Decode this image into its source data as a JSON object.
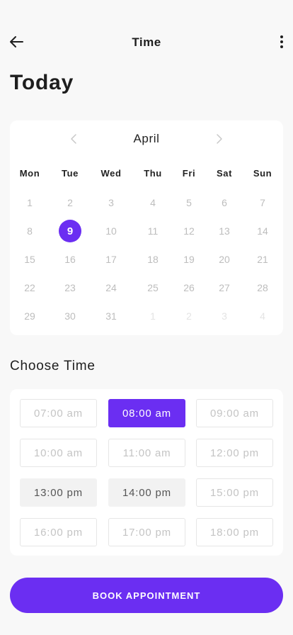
{
  "header": {
    "title": "Time",
    "back_icon": "arrow-left-icon",
    "menu_icon": "more-vertical-icon"
  },
  "page_heading": "Today",
  "calendar": {
    "month": "April",
    "prev_icon": "chevron-left-icon",
    "next_icon": "chevron-right-icon",
    "weekdays": [
      "Mon",
      "Tue",
      "Wed",
      "Thu",
      "Fri",
      "Sat",
      "Sun"
    ],
    "weeks": [
      [
        {
          "d": "1"
        },
        {
          "d": "2"
        },
        {
          "d": "3"
        },
        {
          "d": "4"
        },
        {
          "d": "5"
        },
        {
          "d": "6"
        },
        {
          "d": "7"
        }
      ],
      [
        {
          "d": "8"
        },
        {
          "d": "9",
          "selected": true
        },
        {
          "d": "10"
        },
        {
          "d": "11"
        },
        {
          "d": "12"
        },
        {
          "d": "13"
        },
        {
          "d": "14"
        }
      ],
      [
        {
          "d": "15"
        },
        {
          "d": "16"
        },
        {
          "d": "17"
        },
        {
          "d": "18"
        },
        {
          "d": "19"
        },
        {
          "d": "20"
        },
        {
          "d": "21"
        }
      ],
      [
        {
          "d": "22"
        },
        {
          "d": "23"
        },
        {
          "d": "24"
        },
        {
          "d": "25"
        },
        {
          "d": "26"
        },
        {
          "d": "27"
        },
        {
          "d": "28"
        }
      ],
      [
        {
          "d": "29"
        },
        {
          "d": "30"
        },
        {
          "d": "31"
        },
        {
          "d": "1",
          "muted": true
        },
        {
          "d": "2",
          "muted": true
        },
        {
          "d": "3",
          "muted": true
        },
        {
          "d": "4",
          "muted": true
        }
      ]
    ]
  },
  "time_section": {
    "title": "Choose Time",
    "slots": [
      {
        "label": "07:00 am",
        "state": "available"
      },
      {
        "label": "08:00 am",
        "state": "selected"
      },
      {
        "label": "09:00 am",
        "state": "available"
      },
      {
        "label": "10:00 am",
        "state": "available"
      },
      {
        "label": "11:00 am",
        "state": "available"
      },
      {
        "label": "12:00 pm",
        "state": "available"
      },
      {
        "label": "13:00 pm",
        "state": "booked"
      },
      {
        "label": "14:00 pm",
        "state": "booked"
      },
      {
        "label": "15:00 pm",
        "state": "available"
      },
      {
        "label": "16:00 pm",
        "state": "available"
      },
      {
        "label": "17:00 pm",
        "state": "available"
      },
      {
        "label": "18:00 pm",
        "state": "available"
      }
    ]
  },
  "cta": {
    "label": "BOOK APPOINTMENT"
  },
  "colors": {
    "accent": "#6b2ef2",
    "background": "#f8f8f8",
    "card": "#ffffff"
  }
}
